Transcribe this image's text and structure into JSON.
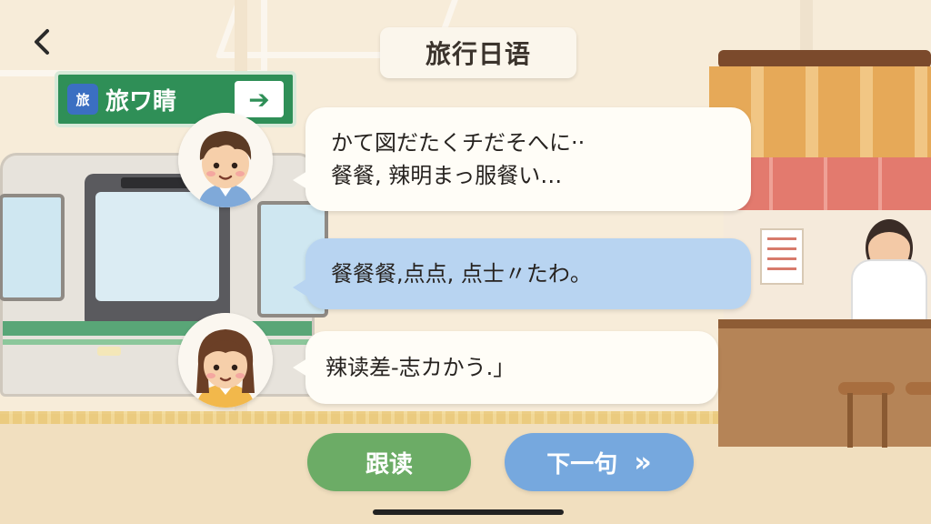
{
  "app": {
    "title": "旅行日语"
  },
  "scene": {
    "station_sign": {
      "badge": "旅",
      "text": "旅ワ睛",
      "arrow": "➔"
    }
  },
  "dialogue": [
    {
      "speaker": "boy",
      "style": "white",
      "lines": [
        "かて図だたくチだそへに··",
        "餐餐, 辣明まっ服餐い…"
      ]
    },
    {
      "speaker": "boy",
      "style": "blue",
      "lines": [
        "餐餐餐,点点, 点士〃たわ。"
      ]
    },
    {
      "speaker": "girl",
      "style": "white",
      "lines": [
        "辣读差-志カかう.」"
      ]
    }
  ],
  "buttons": {
    "shadow_read": "跟读",
    "next": "下一句",
    "next_icon": "»"
  },
  "icons": {
    "back": "chevron-left-icon",
    "next": "double-chevron-right-icon"
  },
  "colors": {
    "green_button": "#6cac66",
    "blue_button": "#76a8de",
    "blue_bubble": "#b8d4f1",
    "white_bubble": "#fffdf7"
  }
}
